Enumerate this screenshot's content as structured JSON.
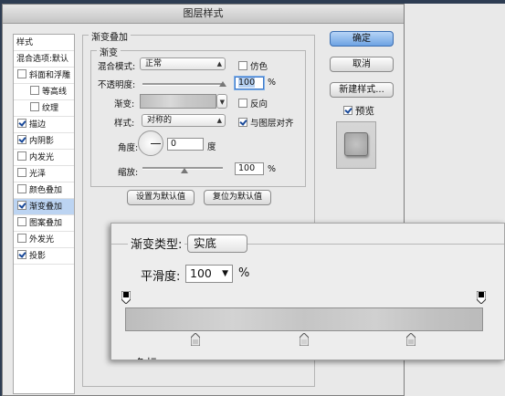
{
  "window": {
    "title": "图层样式"
  },
  "style_list": {
    "items": [
      {
        "label": "样式",
        "checkbox": false,
        "checked": false,
        "selected": false,
        "indent": 0
      },
      {
        "label": "混合选项:默认",
        "checkbox": false,
        "checked": false,
        "selected": false,
        "indent": 0
      },
      {
        "label": "斜面和浮雕",
        "checkbox": true,
        "checked": false,
        "selected": false,
        "indent": 0
      },
      {
        "label": "等高线",
        "checkbox": true,
        "checked": false,
        "selected": false,
        "indent": 1
      },
      {
        "label": "纹理",
        "checkbox": true,
        "checked": false,
        "selected": false,
        "indent": 1
      },
      {
        "label": "描边",
        "checkbox": true,
        "checked": true,
        "selected": false,
        "indent": 0
      },
      {
        "label": "内阴影",
        "checkbox": true,
        "checked": true,
        "selected": false,
        "indent": 0
      },
      {
        "label": "内发光",
        "checkbox": true,
        "checked": false,
        "selected": false,
        "indent": 0
      },
      {
        "label": "光泽",
        "checkbox": true,
        "checked": false,
        "selected": false,
        "indent": 0
      },
      {
        "label": "颜色叠加",
        "checkbox": true,
        "checked": false,
        "selected": false,
        "indent": 0
      },
      {
        "label": "渐变叠加",
        "checkbox": true,
        "checked": true,
        "selected": true,
        "indent": 0
      },
      {
        "label": "图案叠加",
        "checkbox": true,
        "checked": false,
        "selected": false,
        "indent": 0
      },
      {
        "label": "外发光",
        "checkbox": true,
        "checked": false,
        "selected": false,
        "indent": 0
      },
      {
        "label": "投影",
        "checkbox": true,
        "checked": true,
        "selected": false,
        "indent": 0
      }
    ]
  },
  "panel": {
    "title": "渐变叠加",
    "subtitle": "渐变",
    "blend_mode": {
      "label": "混合模式:",
      "value": "正常"
    },
    "dither": {
      "label": "仿色",
      "checked": false
    },
    "opacity": {
      "label": "不透明度:",
      "value": "100",
      "unit": "%",
      "level": 1.0
    },
    "gradient": {
      "label": "渐变:"
    },
    "reverse": {
      "label": "反向",
      "checked": false
    },
    "style": {
      "label": "样式:",
      "value": "对称的"
    },
    "align": {
      "label": "与图层对齐",
      "checked": true
    },
    "angle": {
      "label": "角度:",
      "value": "0",
      "unit": "度"
    },
    "scale": {
      "label": "缩放:",
      "value": "100",
      "unit": "%",
      "level": 0.52
    },
    "set_default": "设置为默认值",
    "reset_default": "复位为默认值"
  },
  "buttons": {
    "ok": "确定",
    "cancel": "取消",
    "new_style": "新建样式..."
  },
  "preview": {
    "label": "预览",
    "checked": true
  },
  "gradient_editor": {
    "type_label": "渐变类型:",
    "type_value": "实底",
    "smoothness_label": "平滑度:",
    "smoothness_value": "100",
    "smoothness_unit": "%",
    "cut_text": "色标"
  },
  "colors": {
    "background": "#2e3d53",
    "selection": "#bcd4f2",
    "primary_button": "#6ea3e3"
  }
}
